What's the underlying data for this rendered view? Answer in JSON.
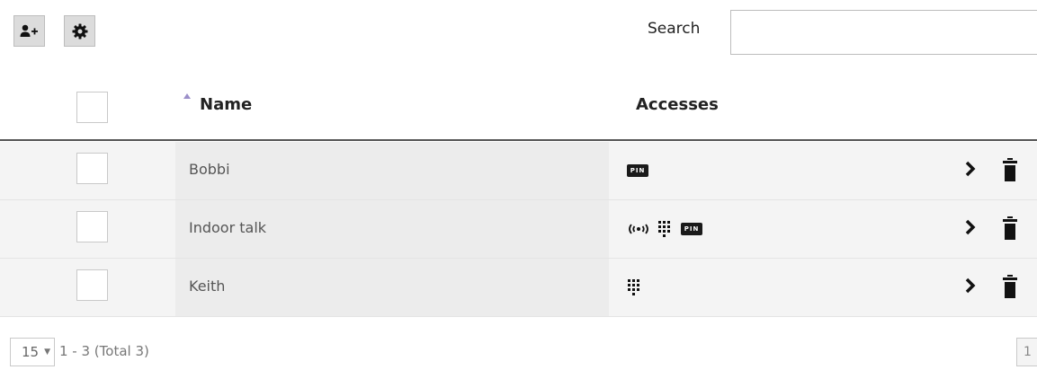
{
  "toolbar": {
    "add_icon": "add-user-icon",
    "settings_icon": "gear-icon"
  },
  "search": {
    "label": "Search",
    "value": "",
    "placeholder": ""
  },
  "table": {
    "headers": {
      "name": "Name",
      "accesses": "Accesses"
    },
    "rows": [
      {
        "name": "Bobbi",
        "accesses": [
          "PIN"
        ]
      },
      {
        "name": "Indoor talk",
        "accesses": [
          "wireless",
          "keypad",
          "PIN"
        ]
      },
      {
        "name": "Keith",
        "accesses": [
          "keypad"
        ]
      }
    ]
  },
  "pagination": {
    "page_size": "15",
    "summary": "1 - 3 (Total 3)",
    "current_page": "1"
  },
  "colors": {
    "sort_arrow": "#9b8fc9",
    "header_line": "#555555",
    "row_bg": "#f4f4f4"
  }
}
